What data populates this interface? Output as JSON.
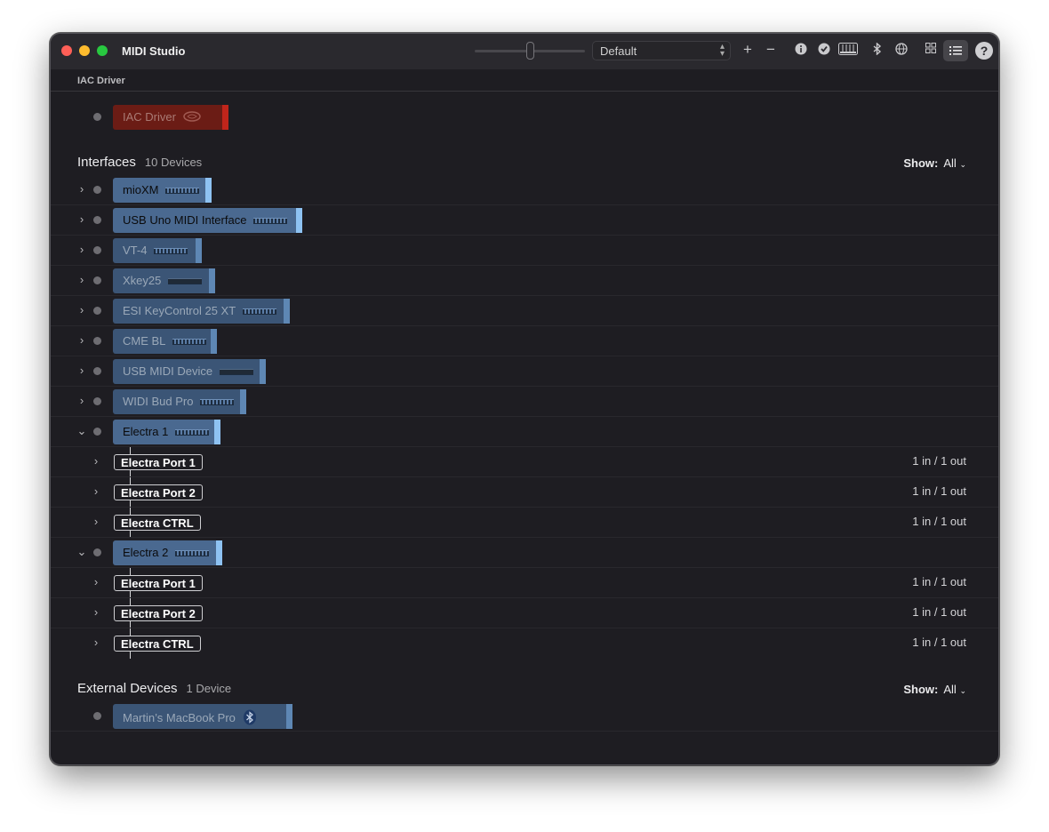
{
  "window": {
    "title": "MIDI Studio"
  },
  "toolbar": {
    "configuration": "Default",
    "add_label": "+",
    "remove_label": "−",
    "help_label": "?"
  },
  "sections": {
    "iac": {
      "title": "IAC Driver",
      "devices": [
        {
          "name": "IAC Driver"
        }
      ]
    },
    "interfaces": {
      "title": "Interfaces",
      "count": "10 Devices",
      "show_label": "Show:",
      "show_value": "All",
      "devices": [
        {
          "name": "mioXM",
          "active": true,
          "expanded": false
        },
        {
          "name": "USB Uno MIDI Interface",
          "active": true,
          "expanded": false
        },
        {
          "name": "VT-4",
          "active": false,
          "expanded": false
        },
        {
          "name": "Xkey25",
          "active": false,
          "expanded": false
        },
        {
          "name": "ESI KeyControl 25 XT",
          "active": false,
          "expanded": false
        },
        {
          "name": "CME BL",
          "active": false,
          "expanded": false
        },
        {
          "name": "USB MIDI Device",
          "active": false,
          "expanded": false
        },
        {
          "name": "WIDI Bud Pro",
          "active": false,
          "expanded": false
        },
        {
          "name": "Electra 1",
          "active": true,
          "expanded": true,
          "ports": [
            {
              "name": "Electra Port 1",
              "io": "1 in / 1 out"
            },
            {
              "name": "Electra Port 2",
              "io": "1 in / 1 out"
            },
            {
              "name": "Electra CTRL",
              "io": "1 in / 1 out"
            }
          ]
        },
        {
          "name": "Electra 2",
          "active": true,
          "expanded": true,
          "ports": [
            {
              "name": "Electra Port 1",
              "io": "1 in / 1 out"
            },
            {
              "name": "Electra Port 2",
              "io": "1 in / 1 out"
            },
            {
              "name": "Electra CTRL",
              "io": "1 in / 1 out"
            }
          ]
        }
      ]
    },
    "external": {
      "title": "External Devices",
      "count": "1 Device",
      "show_label": "Show:",
      "show_value": "All",
      "devices": [
        {
          "name": "Martin’s MacBook Pro",
          "icon": "bluetooth-icon"
        }
      ]
    }
  },
  "colors": {
    "window_bg": "#1e1d22",
    "device_active": "#4a6990",
    "device_inactive": "#3b5576",
    "iac_device": "#6b1c15",
    "active_accent": "#8ec2f2"
  }
}
